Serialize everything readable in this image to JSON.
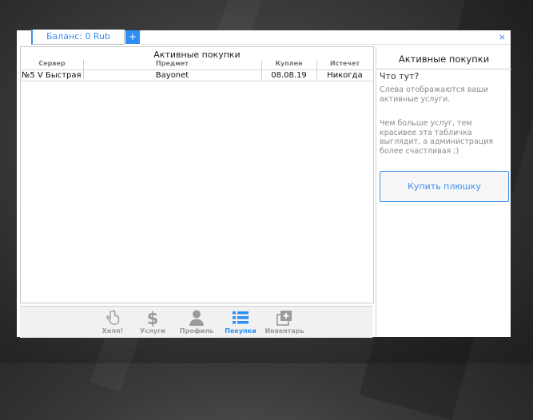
{
  "header": {
    "balance_tab": "Баланс: 0 Rub",
    "add_tab": "+",
    "close": "×"
  },
  "purchases": {
    "title": "Активные покупки",
    "columns": [
      "Сервер",
      "Предмет",
      "Куплен",
      "Истечет"
    ],
    "rows": [
      {
        "server": "№5 V Быстрая",
        "item": "Bayonet",
        "bought": "08.08.19",
        "expires": "Никогда"
      }
    ]
  },
  "nav": [
    {
      "label": "Хелп!",
      "icon": "hand-pointer-icon",
      "active": false
    },
    {
      "label": "Услуги",
      "icon": "dollar-icon",
      "active": false
    },
    {
      "label": "Профиль",
      "icon": "user-icon",
      "active": false
    },
    {
      "label": "Покупки",
      "icon": "list-icon",
      "active": true
    },
    {
      "label": "Инвентарь",
      "icon": "add-box-icon",
      "active": false
    }
  ],
  "sidebar": {
    "title": "Активные покупки",
    "question": "Что тут?",
    "text1": "Слева отображаются ваши активные услуги.",
    "text2": "Чем больше услуг, тем красивее эта табличка выглядит, а администрация более счастливая ;)",
    "buy_button": "Купить плюшку"
  },
  "colors": {
    "accent": "#2e8ef3",
    "nav_inactive": "#9a9a9a"
  }
}
